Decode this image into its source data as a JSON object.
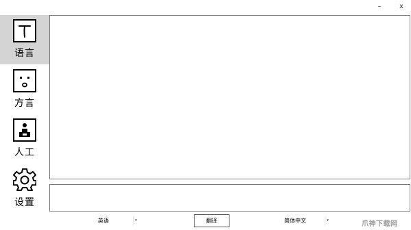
{
  "titlebar": {
    "minimize_symbol": "–",
    "close_symbol": "x"
  },
  "sidebar": {
    "items": [
      {
        "label": "语言",
        "icon": "text-t-icon",
        "active": true
      },
      {
        "label": "方言",
        "icon": "face-icon",
        "active": false
      },
      {
        "label": "人工",
        "icon": "person-podium-icon",
        "active": false
      },
      {
        "label": "设置",
        "icon": "gear-icon",
        "active": false
      }
    ]
  },
  "source_text": {
    "value": ""
  },
  "result_text": {
    "value": ""
  },
  "controls": {
    "source_language": "英语",
    "target_language": "简体中文",
    "translate_label": "翻译",
    "dropdown_arrow": "▾"
  },
  "watermark": "爪神下载网",
  "colors": {
    "active_tab_bg": "#d4d4d4",
    "border": "#7a7a7a"
  }
}
